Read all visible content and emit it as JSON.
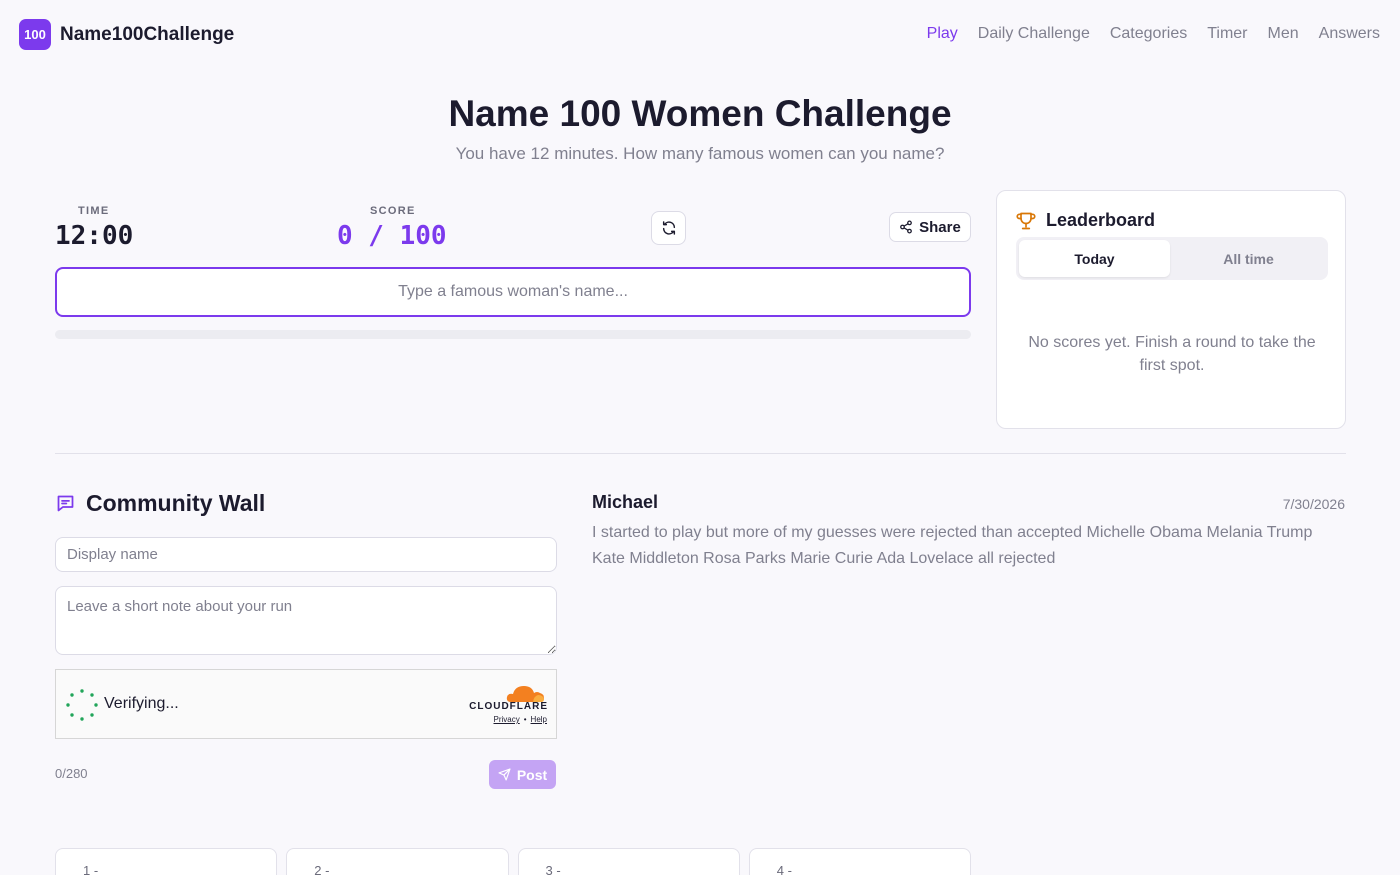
{
  "nav": {
    "logo": "100",
    "brand": "Name100Challenge",
    "links": [
      "Play",
      "Daily Challenge",
      "Categories",
      "Timer",
      "Men",
      "Answers"
    ],
    "active": "Play"
  },
  "hero": {
    "title": "Name 100 Women Challenge",
    "subtitle": "You have 12 minutes. How many famous women can you name?"
  },
  "game": {
    "time_label": "TIME",
    "time_value": "12:00",
    "score_label": "SCORE",
    "score_value": "0 / 100",
    "share_label": "Share",
    "input_placeholder": "Type a famous woman's name...",
    "progress": 0
  },
  "leaderboard": {
    "title": "Leaderboard",
    "tabs": [
      "Today",
      "All time"
    ],
    "empty_text": "No scores yet. Finish a round to take the first spot."
  },
  "community": {
    "title": "Community Wall",
    "name_placeholder": "Display name",
    "note_placeholder": "Leave a short note about your run",
    "captcha_status": "Verifying...",
    "captcha_brand": "CLOUDFLARE",
    "captcha_privacy": "Privacy",
    "captcha_sep": "•",
    "captcha_help": "Help",
    "char_count": "0/280",
    "post_label": "Post",
    "comment": {
      "author": "Michael",
      "date": "7/30/2026",
      "body": "I started to play but more of my guesses were rejected than accepted Michelle Obama Melania Trump Kate Middleton Rosa Parks Marie Curie Ada Lovelace all rejected"
    }
  },
  "slots": [
    "1 -",
    "2 -",
    "3 -",
    "4 -"
  ],
  "colors": {
    "accent": "#7c3aed",
    "muted": "#80808f",
    "trophy": "#d97706",
    "cloudflare": "#f38020"
  }
}
